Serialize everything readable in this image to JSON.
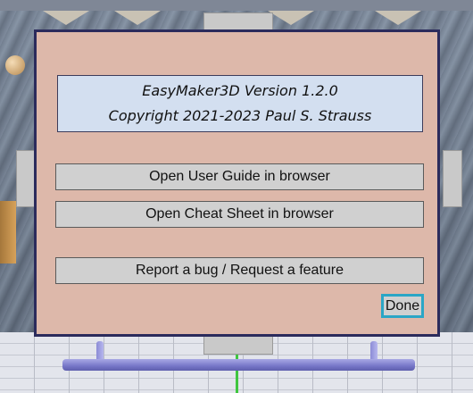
{
  "info": {
    "version_line": "EasyMaker3D Version 1.2.0",
    "copyright_line": "Copyright 2021-2023 Paul S. Strauss"
  },
  "buttons": {
    "user_guide": "Open User Guide in browser",
    "cheat_sheet": "Open Cheat Sheet in browser",
    "report_bug": "Report a bug / Request a feature",
    "done": "Done"
  },
  "colors": {
    "panel_bg": "#ddb8aa",
    "panel_border": "#2b2b5c",
    "info_bg": "#d3dff0",
    "button_bg": "#d0d0d0",
    "done_highlight": "#2aa6c6",
    "axis_green": "#3fc63f"
  }
}
